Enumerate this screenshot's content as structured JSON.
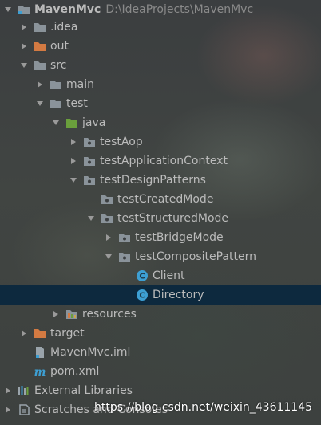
{
  "project": {
    "name": "MavenMvc",
    "path": "D:\\IdeaProjects\\MavenMvc"
  },
  "tree": {
    "idea": ".idea",
    "out": "out",
    "src": "src",
    "main": "main",
    "test": "test",
    "java": "java",
    "testAop": "testAop",
    "testApplicationContext": "testApplicationContext",
    "testDesignPatterns": "testDesignPatterns",
    "testCreatedMode": "testCreatedMode",
    "testStructuredMode": "testStructuredMode",
    "testBridgeMode": "testBridgeMode",
    "testCompositePattern": "testCompositePattern",
    "client": "Client",
    "directory": "Directory",
    "resources": "resources",
    "target": "target",
    "iml": "MavenMvc.iml",
    "pom": "pom.xml",
    "external": "External Libraries",
    "scratches": "Scratches and Consoles"
  },
  "watermark": "https://blog.csdn.net/weixin_43611145",
  "colors": {
    "folder_gray": "#8a939a",
    "folder_orange": "#d37a42",
    "folder_green": "#6a9f3c",
    "class_icon": "#3d9fd3",
    "selection": "#0d293e",
    "text": "#bbbbbb"
  }
}
